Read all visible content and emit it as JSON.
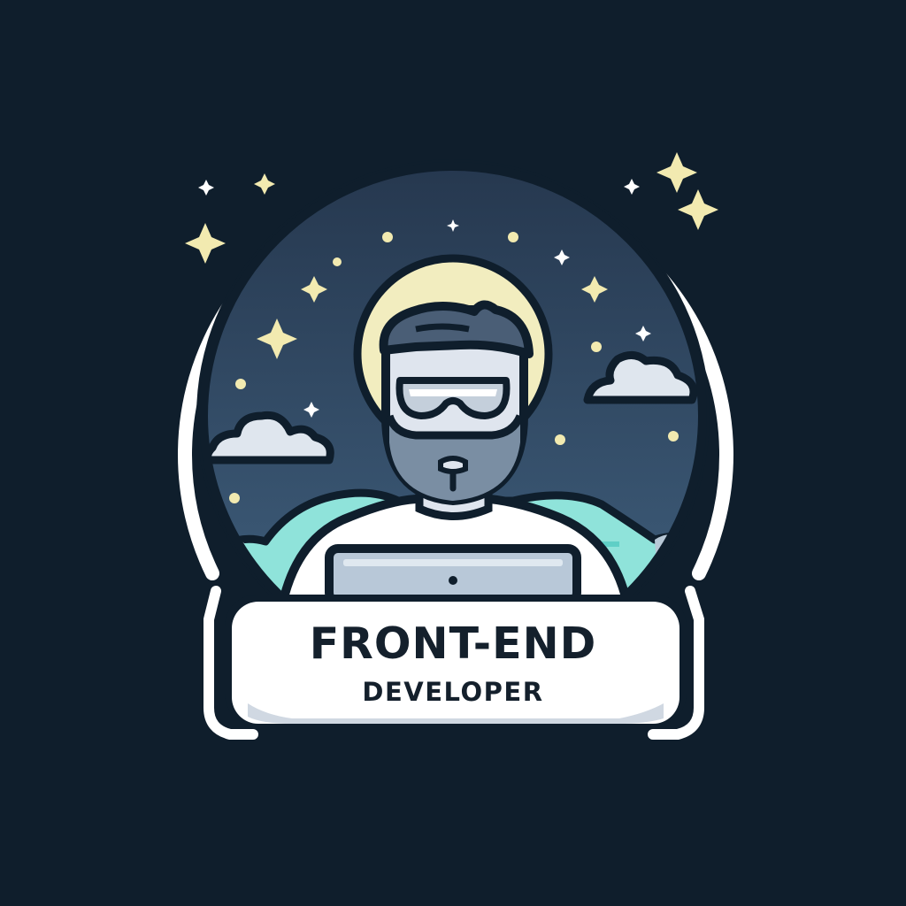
{
  "badge": {
    "title": "FRONT-END",
    "subtitle": "DEVELOPER"
  },
  "colors": {
    "background": "#0f1e2c",
    "sky_top": "#2a3c55",
    "sky_bottom": "#3c5a78",
    "ring": "#ffffff",
    "halo": "#f5f0c0",
    "star": "#f2eab0",
    "skin": "#dfe5ee",
    "beard": "#6f8297",
    "hills": "#7fe0d8",
    "outline": "#0f1e2c",
    "label_fill": "#ffffff",
    "label_text": "#14202c"
  },
  "icons": {
    "figure": "developer-avatar-icon",
    "laptop": "laptop-icon",
    "stars": "sparkle-icon",
    "clouds": "cloud-icon"
  }
}
